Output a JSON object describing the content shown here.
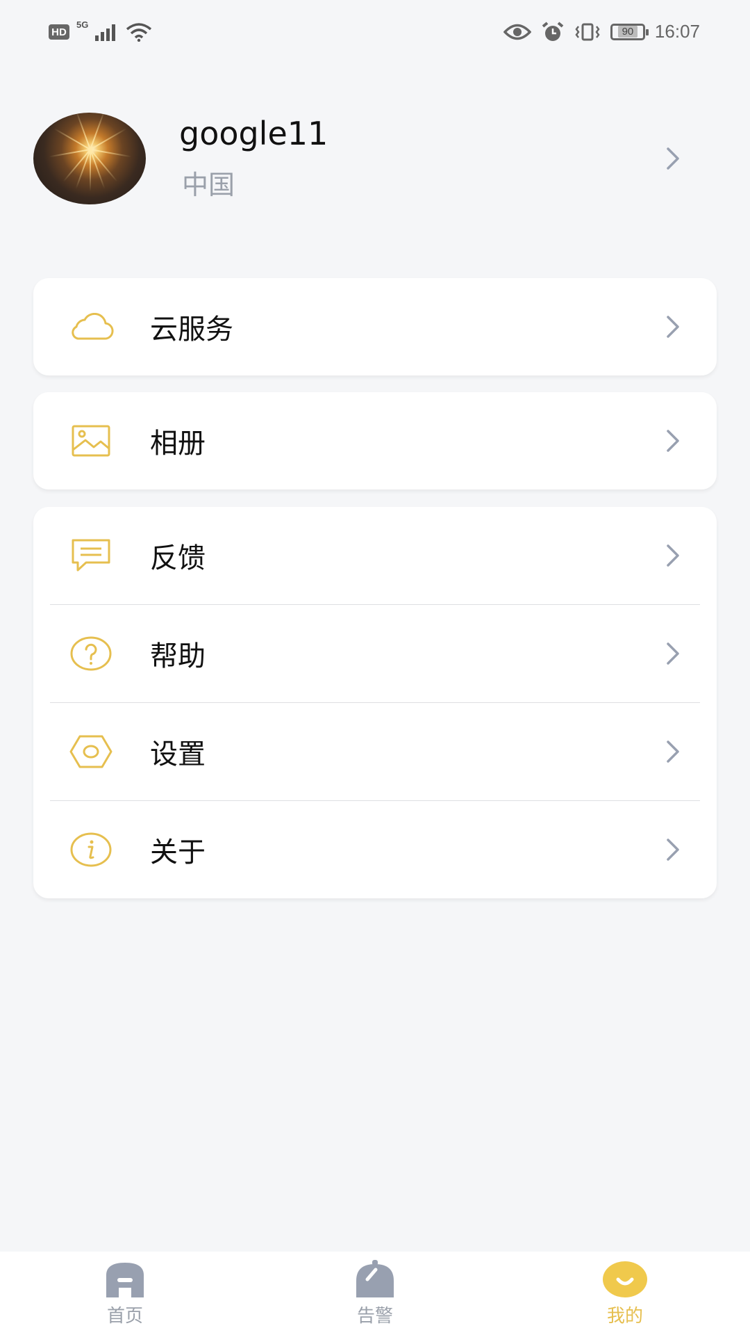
{
  "status_bar": {
    "hd": "HD",
    "network": "5G",
    "battery": "90",
    "time": "16:07"
  },
  "profile": {
    "username": "google11",
    "region": "中国"
  },
  "menu": {
    "cloud": {
      "label": "云服务",
      "icon": "cloud-icon"
    },
    "album": {
      "label": "相册",
      "icon": "image-icon"
    },
    "feedback": {
      "label": "反馈",
      "icon": "message-icon"
    },
    "help": {
      "label": "帮助",
      "icon": "question-icon"
    },
    "settings": {
      "label": "设置",
      "icon": "hexagon-settings-icon"
    },
    "about": {
      "label": "关于",
      "icon": "info-icon"
    }
  },
  "bottom_nav": {
    "home": {
      "label": "首页",
      "icon": "home-icon"
    },
    "alarm": {
      "label": "告警",
      "icon": "bell-icon"
    },
    "mine": {
      "label": "我的",
      "icon": "smile-icon",
      "active": true
    }
  },
  "colors": {
    "accent": "#e6bf4f",
    "icon_gray": "#98a0b0",
    "background": "#f5f6f8"
  }
}
